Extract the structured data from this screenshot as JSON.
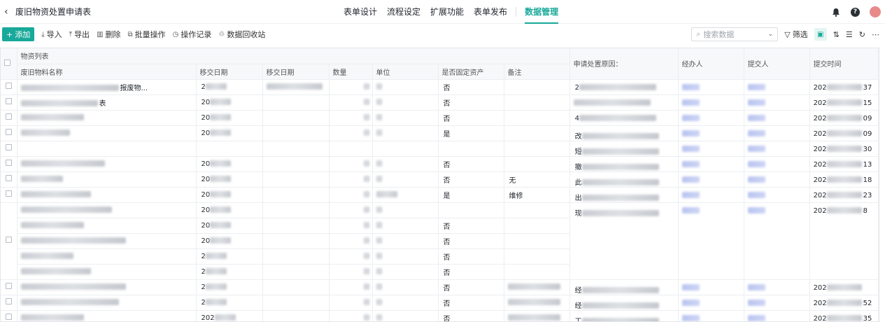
{
  "header": {
    "title": "废旧物资处置申请表",
    "nav": [
      "表单设计",
      "流程设定",
      "扩展功能",
      "表单发布",
      "数据管理"
    ],
    "active_nav": "数据管理"
  },
  "toolbar": {
    "add": "添加",
    "import": "导入",
    "export": "导出",
    "delete": "删除",
    "batch": "批量操作",
    "log": "操作记录",
    "recycle": "数据回收站",
    "search_placeholder": "搜索数据",
    "filter": "筛选"
  },
  "table": {
    "group_header": "物资列表",
    "sub_columns": [
      "废旧物料名称",
      "移交日期",
      "移交日期",
      "数量",
      "单位",
      "是否固定资产",
      "备注"
    ],
    "main_columns": [
      "申请处置原因：",
      "经办人",
      "提交人",
      "提交时间"
    ],
    "rows": [
      {
        "name_tail": "报废物...",
        "date": "2",
        "fixed": "否",
        "note": "",
        "reason": "2",
        "time": "37"
      },
      {
        "name_tail": "表",
        "date": "20",
        "fixed": "否",
        "note": "",
        "reason": "",
        "time": "15"
      },
      {
        "name_tail": "",
        "date": "20",
        "fixed": "否",
        "note": "",
        "reason": "4",
        "time": "09"
      },
      {
        "name_tail": "",
        "date": "20",
        "fixed": "是",
        "note": "",
        "reason": "改",
        "time": "09"
      },
      {
        "name_tail": "",
        "date": "",
        "fixed": "",
        "note": "",
        "reason": "短",
        "time": "30"
      },
      {
        "name_tail": "",
        "date": "20",
        "fixed": "否",
        "note": "",
        "reason": "撤",
        "time": "13"
      },
      {
        "name_tail": "",
        "date": "20",
        "fixed": "否",
        "note": "无",
        "reason": "此",
        "time": "18"
      },
      {
        "name_tail": "",
        "date": "20",
        "fixed": "是",
        "note": "维修",
        "reason": "出",
        "time": "23"
      },
      {
        "name_tail": "",
        "date": "20",
        "fixed": "",
        "note": "",
        "reason": "现",
        "time": "8"
      },
      {
        "name_tail": "",
        "date": "20",
        "fixed": "否",
        "note": "",
        "reason": "",
        "time": ""
      },
      {
        "name_tail": "",
        "date": "20",
        "fixed": "否",
        "note": "",
        "reason": "",
        "time": ""
      },
      {
        "name_tail": "",
        "date": "2",
        "fixed": "否",
        "note": "",
        "reason": "",
        "time": ""
      },
      {
        "name_tail": "",
        "date": "2",
        "fixed": "否",
        "note": "",
        "reason": "",
        "time": ""
      },
      {
        "name_tail": "",
        "date": "2",
        "fixed": "否",
        "note": "",
        "reason": "经",
        "time": ""
      },
      {
        "name_tail": "",
        "date": "2",
        "fixed": "否",
        "note": "",
        "reason": "经",
        "time": "52"
      },
      {
        "name_tail": "",
        "date": "202",
        "fixed": "否",
        "note": "",
        "reason": "工",
        "time": "35"
      }
    ]
  },
  "colors": {
    "accent": "#18a99a"
  },
  "icons": [
    "back-icon",
    "bell-icon",
    "help-icon",
    "avatar",
    "plus-icon",
    "import-icon",
    "export-icon",
    "delete-icon",
    "batch-icon",
    "log-icon",
    "recycle-icon",
    "search-icon",
    "filter-icon"
  ]
}
